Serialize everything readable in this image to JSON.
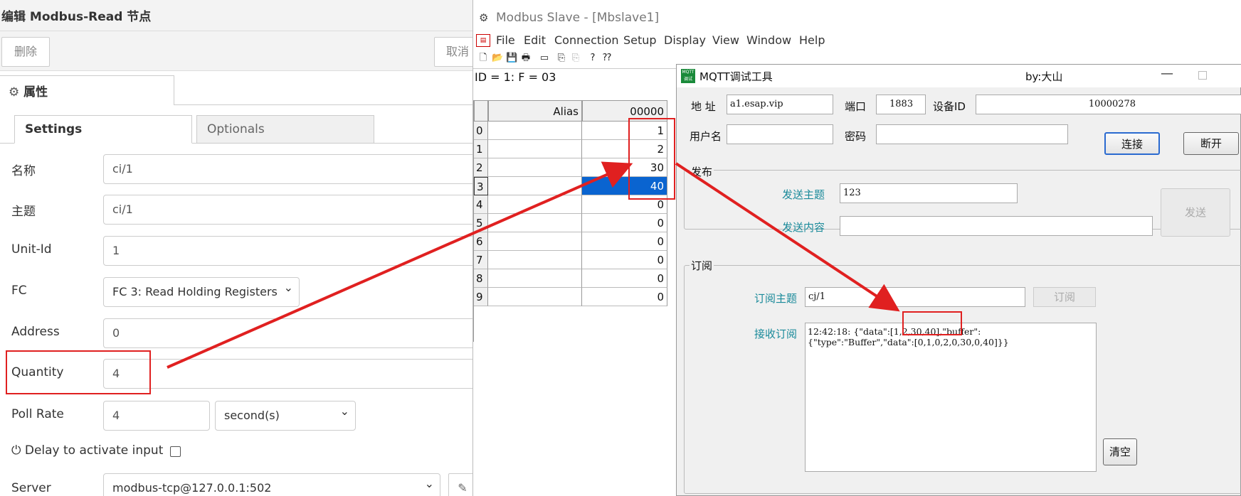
{
  "nodered": {
    "title": "编辑 Modbus-Read 节点",
    "delete_label": "删除",
    "cancel_label": "取消",
    "props_tab_label": "属性",
    "subtabs": [
      "Settings",
      "Optionals"
    ],
    "fields": {
      "name": {
        "label": "名称",
        "value": "ci/1"
      },
      "topic": {
        "label": "主题",
        "value": "ci/1"
      },
      "unit_id": {
        "label": "Unit-Id",
        "value": "1"
      },
      "fc": {
        "label": "FC",
        "value": "FC 3: Read Holding Registers"
      },
      "address": {
        "label": "Address",
        "value": "0"
      },
      "quantity": {
        "label": "Quantity",
        "value": "4"
      },
      "poll_rate": {
        "label": "Poll Rate",
        "value": "4",
        "unit": "second(s)"
      },
      "delay": {
        "label": "Delay to activate input"
      },
      "server": {
        "label": "Server",
        "value": "modbus-tcp@127.0.0.1:502"
      }
    }
  },
  "modbus": {
    "title": "Modbus Slave - [Mbslave1]",
    "menu": [
      "File",
      "Edit",
      "Connection",
      "Setup",
      "Display",
      "View",
      "Window",
      "Help"
    ],
    "id_line": "ID = 1: F = 03",
    "alias_header": "Alias",
    "addr_header": "00000",
    "rows": [
      {
        "idx": "0",
        "value": "1"
      },
      {
        "idx": "1",
        "value": "2"
      },
      {
        "idx": "2",
        "value": "30"
      },
      {
        "idx": "3",
        "value": "40"
      },
      {
        "idx": "4",
        "value": "0"
      },
      {
        "idx": "5",
        "value": "0"
      },
      {
        "idx": "6",
        "value": "0"
      },
      {
        "idx": "7",
        "value": "0"
      },
      {
        "idx": "8",
        "value": "0"
      },
      {
        "idx": "9",
        "value": "0"
      }
    ]
  },
  "mqtt": {
    "title": "MQTT调试工具",
    "by": "by:大山",
    "addr_label": "地 址",
    "addr_value": "a1.esap.vip",
    "port_label": "端口",
    "port_value": "1883",
    "device_label": "设备ID",
    "device_value": "10000278",
    "user_label": "用户名",
    "pass_label": "密码",
    "connect_label": "连接",
    "disconnect_label": "断开",
    "publish_group": "发布",
    "pub_topic_label": "发送主题",
    "pub_topic_value": "123",
    "pub_content_label": "发送内容",
    "send_label": "发送",
    "subscribe_group": "订阅",
    "sub_topic_label": "订阅主题",
    "sub_topic_value": "cj/1",
    "subscribe_label": "订阅",
    "recv_label": "接收订阅",
    "recv_line1": "12:42:18: {\"data\":[1,2,30,40],\"buffer\":",
    "recv_line2": "{\"type\":\"Buffer\",\"data\":[0,1,0,2,0,30,0,40]}}",
    "clear_label": "清空"
  },
  "colors": {
    "annotation_red": "#e02020",
    "selected_cell": "#0a64d0",
    "teal_label": "#1a8a9a"
  }
}
